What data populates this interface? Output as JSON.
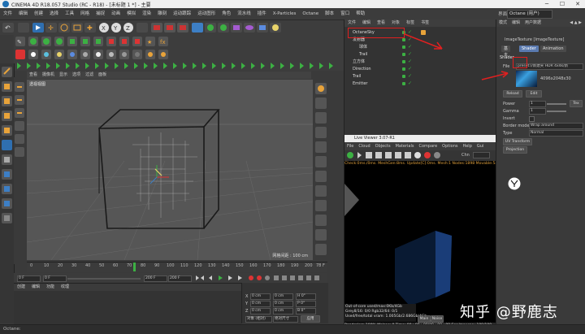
{
  "window": {
    "title": "CINEMA 4D R18.057 Studio (RC - R18) - [未标题 1 *] - 主要",
    "minimize": "─",
    "maximize": "☐",
    "close": "✕"
  },
  "menubar": {
    "items": [
      "文件",
      "编辑",
      "创建",
      "选择",
      "工具",
      "网格",
      "捕捉",
      "动画",
      "模拟",
      "渲染",
      "雕刻",
      "运动跟踪",
      "运动图形",
      "角色",
      "流水线",
      "插件",
      "X-Particles",
      "Octane",
      "脚本",
      "窗口",
      "帮助"
    ],
    "layout_label": "界面:",
    "layout_value": "Octane (用户)"
  },
  "viewport": {
    "menu": [
      "查看",
      "摄像机",
      "显示",
      "选项",
      "过滤",
      "面板"
    ],
    "title": "透视视图",
    "grid_label": "网格间距 : 100 cm"
  },
  "timeline": {
    "ticks": [
      "0",
      "10",
      "20",
      "30",
      "40",
      "50",
      "60",
      "70",
      "80",
      "90",
      "100",
      "110",
      "120",
      "130",
      "140",
      "150",
      "160",
      "170",
      "180",
      "190",
      "200"
    ],
    "frame_right": "78 F",
    "current_frame": "0 F",
    "start_frame": "0 F",
    "end_frame": "200 F",
    "end_frame2": "200 F"
  },
  "materials": {
    "menu": [
      "创建",
      "编辑",
      "功能",
      "纹理"
    ]
  },
  "coords": {
    "rows": [
      {
        "axis": "X",
        "pos": "0 cm",
        "size": "0 cm",
        "rot": "H 0°"
      },
      {
        "axis": "Y",
        "pos": "0 cm",
        "size": "0 cm",
        "rot": "P 0°"
      },
      {
        "axis": "Z",
        "pos": "0 cm",
        "size": "0 cm",
        "rot": "B 0°"
      }
    ],
    "mode": "对象 (相对)",
    "size_mode": "绝对尺寸",
    "apply": "应用"
  },
  "object_manager": {
    "menu": [
      "文件",
      "编辑",
      "查看",
      "对象",
      "标签",
      "书签"
    ],
    "objects": [
      {
        "name": "OctaneSky",
        "indent": 0
      },
      {
        "name": "发射器",
        "indent": 0
      },
      {
        "name": "球体",
        "indent": 1
      },
      {
        "name": "Trail",
        "indent": 1
      },
      {
        "name": "立方体",
        "indent": 0
      },
      {
        "name": "Direction",
        "indent": 0
      },
      {
        "name": "Trail",
        "indent": 0
      },
      {
        "name": "Emitter",
        "indent": 0
      }
    ]
  },
  "live_viewer": {
    "title": "Live Viewer 3.07-R1",
    "menu": [
      "File",
      "Cloud",
      "Objects",
      "Materials",
      "Compare",
      "Options",
      "Help",
      "Gui"
    ],
    "channel": "Chn",
    "status": "Check:0ms./0ms. MeshGen:8ms. Update[C]:0ms. Mesh:1 Nodes:1898 Movable:546 0 0",
    "stats": [
      "Out-of-core used/max:0Kb/4Gb",
      "Grey8/16: 0/0        Rgb32/64: 0/1",
      "Used/free/total vram: 1.005Gb/2.686Gb/4Gb"
    ],
    "main_btn": "Main",
    "noise_btn": "Noise",
    "rendering": "Rendering: 100%   Ms/sec: 0   Time: 00 : 00 : 09/00 : 00 : 09   Spp/maxspp: 100/100"
  },
  "attribute_manager": {
    "menu": [
      "模式",
      "编辑",
      "用户数据"
    ],
    "nav": [
      "◀",
      "▲",
      "▶"
    ],
    "object_title": "ImageTexture [ImageTexture]",
    "tabs": [
      "基本",
      "Shader",
      "Animation"
    ],
    "section": "Shader",
    "file_label": "File",
    "file_value": "preset://新建夹 HDR 4x4k/新",
    "file_res": "4096x2048x30",
    "reload": "Reload",
    "edit": "Edit",
    "power_label": "Power",
    "power_value": "1",
    "power_btn": "Tex",
    "gamma_label": "Gamma",
    "gamma_value": "1",
    "invert_label": "Invert",
    "border_label": "Border mode",
    "border_value": "Wrap around",
    "type_label": "Type",
    "type_value": "Normal",
    "uv_transform": "UV Transform",
    "projection": "Projection"
  },
  "statusbar": {
    "text": "Octane:"
  },
  "watermark": "知乎 @野鹿志"
}
